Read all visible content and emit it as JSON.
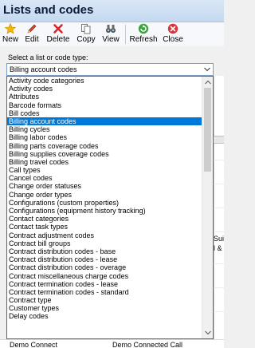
{
  "window": {
    "title": "Lists and codes"
  },
  "toolbar": {
    "buttons": [
      {
        "label": "New",
        "icon": "new-star-icon"
      },
      {
        "label": "Edit",
        "icon": "pencil-icon"
      },
      {
        "label": "Delete",
        "icon": "red-x-icon"
      },
      {
        "label": "Copy",
        "icon": "copy-pages-icon"
      },
      {
        "label": "View",
        "icon": "binoculars-icon"
      },
      {
        "label": "Refresh",
        "icon": "refresh-icon"
      },
      {
        "label": "Close",
        "icon": "close-red-icon"
      }
    ]
  },
  "selector": {
    "prompt": "Select a list or code type:",
    "selected": "Billing account codes",
    "options": [
      "Activity code categories",
      "Activity codes",
      "Attributes",
      "Barcode formats",
      "Bill codes",
      "Billing account codes",
      "Billing cycles",
      "Billing labor codes",
      "Billing parts coverage codes",
      "Billing supplies coverage codes",
      "Billing travel codes",
      "Call types",
      "Cancel codes",
      "Change order statuses",
      "Change order types",
      "Configurations (custom properties)",
      "Configurations (equipment history tracking)",
      "Contact categories",
      "Contact task types",
      "Contract adjustment codes",
      "Contract bill groups",
      "Contract distribution codes - base",
      "Contract distribution codes - lease",
      "Contract distribution codes - overage",
      "Contract miscellaneous charge codes",
      "Contract termination codes - lease",
      "Contract termination codes - standard",
      "Contract type",
      "Customer types",
      "Delay codes"
    ]
  },
  "background_cut_text": {
    "row1": "Sui",
    "row2": "l & C"
  },
  "bottom_row": {
    "col1": "Demo Connect",
    "col2": "Demo Connected Call"
  },
  "colors": {
    "selection": "#0078d7",
    "title_text": "#0b1a3a"
  }
}
